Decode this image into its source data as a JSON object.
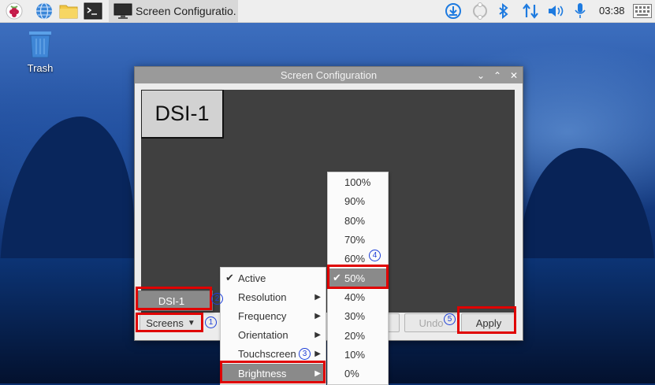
{
  "taskbar": {
    "window_button_label": "Screen Configuratio.",
    "clock": "03:38"
  },
  "desktop": {
    "trash_label": "Trash"
  },
  "dialog": {
    "title": "Screen Configuration",
    "monitor_label": "DSI-1",
    "screens_button": "Screens",
    "undo_button": "Undo",
    "apply_button": "Apply"
  },
  "screens_menu": {
    "items": [
      {
        "label": "DSI-1"
      }
    ]
  },
  "display_menu": {
    "items": [
      {
        "label": "Active",
        "checked": true
      },
      {
        "label": "Resolution"
      },
      {
        "label": "Frequency"
      },
      {
        "label": "Orientation"
      },
      {
        "label": "Touchscreen"
      },
      {
        "label": "Brightness",
        "highlighted": true
      }
    ]
  },
  "brightness_menu": {
    "items": [
      {
        "label": "100%"
      },
      {
        "label": "90%"
      },
      {
        "label": "80%"
      },
      {
        "label": "70%"
      },
      {
        "label": "60%"
      },
      {
        "label": "50%",
        "checked": true,
        "highlighted": true
      },
      {
        "label": "40%"
      },
      {
        "label": "30%"
      },
      {
        "label": "20%"
      },
      {
        "label": "10%"
      },
      {
        "label": "0%"
      }
    ]
  },
  "annotations": {
    "n1": "①",
    "n2": "②",
    "n3": "③",
    "n4": "④",
    "n5": "⑤"
  },
  "colors": {
    "highlight_annotation": "#e00000",
    "number_annotation": "#1d3fd8",
    "menu_highlight": "#8a8a8a",
    "tray_icon": "#1e7be0"
  }
}
